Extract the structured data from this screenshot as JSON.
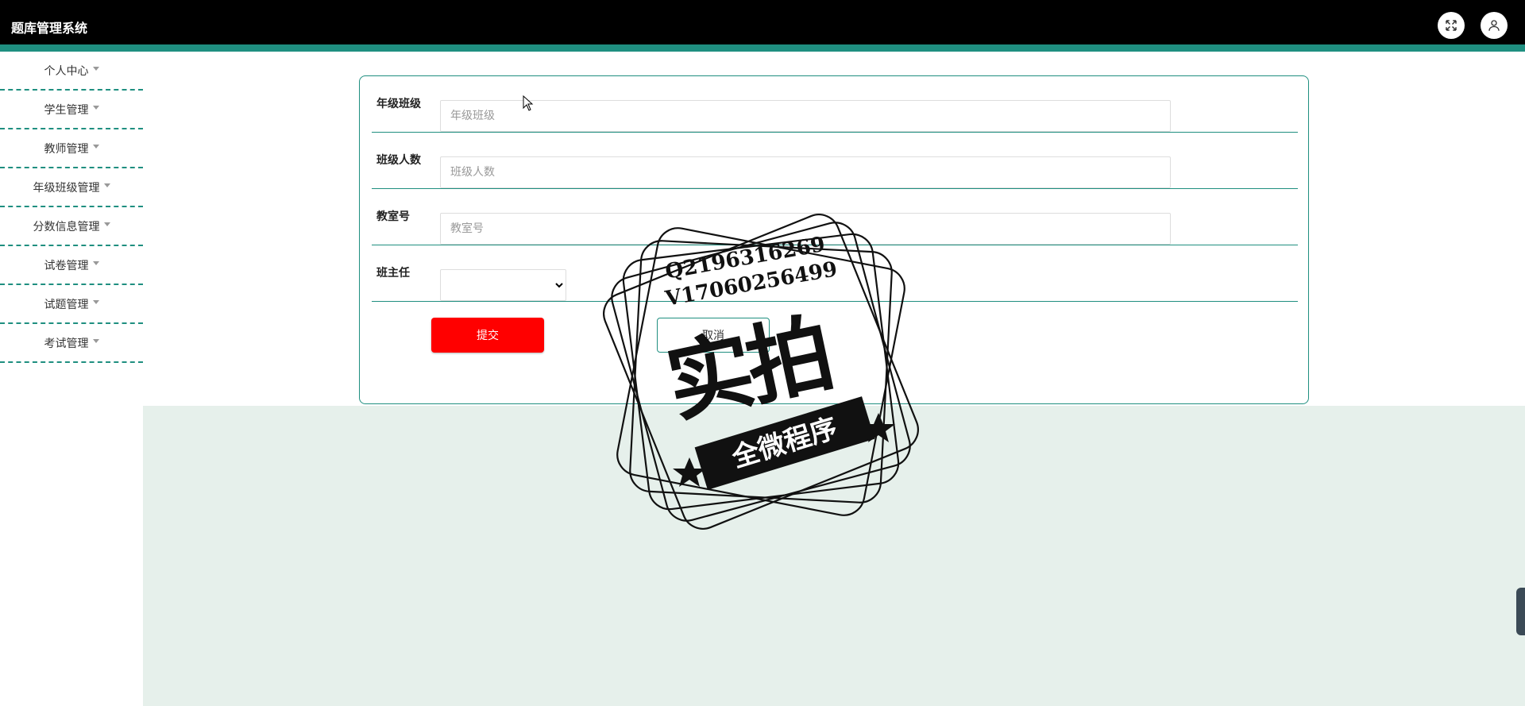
{
  "app": {
    "title": "题库管理系统"
  },
  "header": {
    "fullscreen_icon": "fullscreen-icon",
    "user_icon": "user-icon"
  },
  "sidebar": {
    "items": [
      {
        "label": "个人中心"
      },
      {
        "label": "学生管理"
      },
      {
        "label": "教师管理"
      },
      {
        "label": "年级班级管理"
      },
      {
        "label": "分数信息管理"
      },
      {
        "label": "试卷管理"
      },
      {
        "label": "试题管理"
      },
      {
        "label": "考试管理"
      }
    ]
  },
  "form": {
    "grade_class": {
      "label": "年级班级",
      "placeholder": "年级班级",
      "value": ""
    },
    "class_size": {
      "label": "班级人数",
      "placeholder": "班级人数",
      "value": ""
    },
    "classroom": {
      "label": "教室号",
      "placeholder": "教室号",
      "value": ""
    },
    "head_teacher": {
      "label": "班主任",
      "selected": ""
    },
    "submit_label": "提交",
    "cancel_label": "取消"
  },
  "watermark": {
    "line1": "Q2196316269",
    "line2": "V17060256499",
    "big_text": "实拍",
    "band_text": "全微程序"
  },
  "colors": {
    "accent": "#1f8f80",
    "topbar": "#000000",
    "submit": "#ff0000",
    "content_bg": "#e6f0eb"
  }
}
